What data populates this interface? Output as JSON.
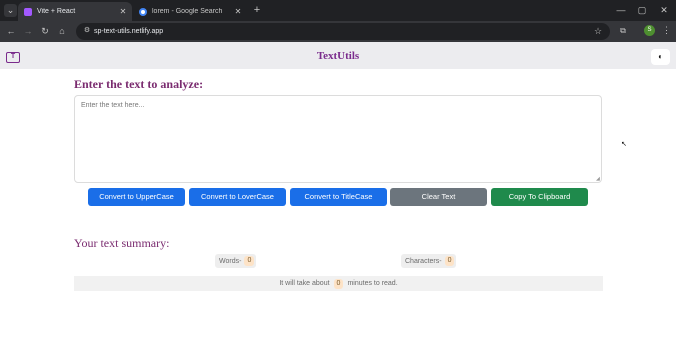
{
  "browser": {
    "tabs": [
      {
        "title": "Vite + React",
        "active": true,
        "favicon_color": "#a259ff"
      },
      {
        "title": "lorem - Google Search",
        "active": false,
        "favicon_color": "#4285f4"
      }
    ],
    "url": "sp-text-utils.netlify.app",
    "profile_initial": "S",
    "icons": {
      "tab_menu": "chevron-down-icon",
      "tab_close": "close-icon",
      "new_tab": "plus-icon",
      "minimize": "minimize-icon",
      "maximize": "maximize-icon",
      "close_window": "close-icon",
      "back": "arrow-left-icon",
      "forward": "arrow-right-icon",
      "reload": "reload-icon",
      "home": "home-icon",
      "site_info": "tune-icon",
      "bookmark": "star-icon",
      "extensions": "puzzle-icon",
      "menu": "kebab-icon"
    }
  },
  "app": {
    "brand": "TextUtils",
    "brand_color": "#7a2b8c",
    "theme_toggle_icon": "moon-icon",
    "heading": "Enter the text to analyze:",
    "textarea": {
      "value": "",
      "placeholder": "Enter the text here..."
    },
    "buttons": {
      "uppercase": "Convert to UpperCase",
      "lowercase": "Convert to LoverCase",
      "titlecase": "Convert to TitleCase",
      "clear": "Clear Text",
      "copy": "Copy To Clipboard"
    },
    "summary": {
      "heading": "Your text summary:",
      "words_label": "Words-",
      "words_count": "0",
      "chars_label": "Characters-",
      "chars_count": "0",
      "read_prefix": "It will take about",
      "read_minutes": "0",
      "read_suffix": "minutes to read."
    }
  },
  "colors": {
    "primary": "#1a6ee8",
    "secondary": "#6c757d",
    "success": "#1f8a4c",
    "heading": "#7a2b6f"
  }
}
